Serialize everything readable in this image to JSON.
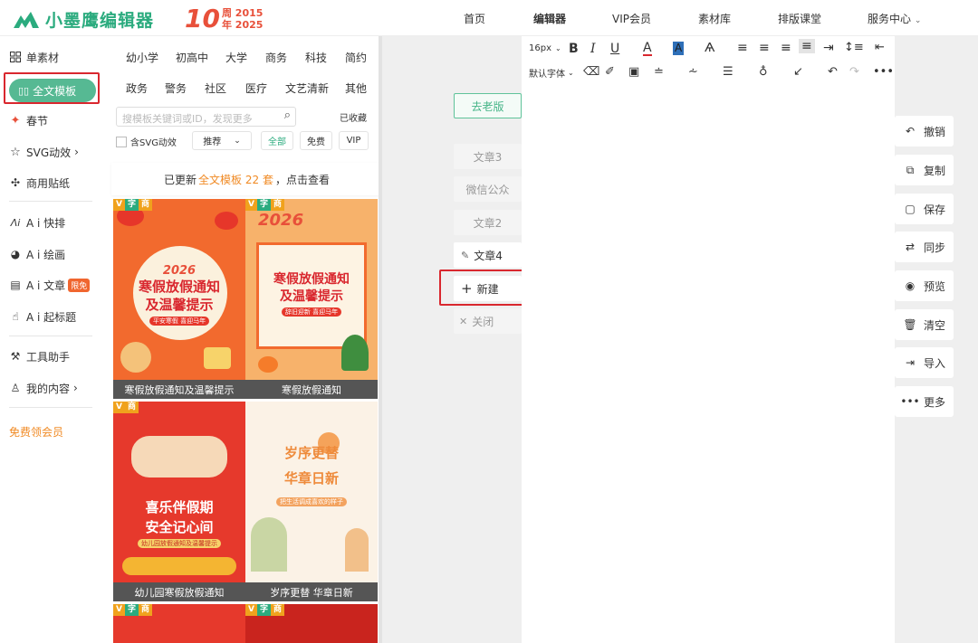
{
  "header": {
    "logo_text": "小墨鹰编辑器",
    "anniv_ten": "10",
    "anniv_line1": "周 2015",
    "anniv_line2": "年 2025",
    "nav": [
      "首页",
      "编辑器",
      "VIP会员",
      "素材库",
      "排版课堂",
      "服务中心"
    ]
  },
  "sidebar": {
    "items": [
      "单素材",
      "全文模板",
      "春节",
      "SVG动效",
      "商用贴纸",
      "A i 快排",
      "A i 绘画",
      "A i 文章",
      "A i 起标题",
      "工具助手",
      "我的内容",
      "免费领会员"
    ],
    "ai_article_badge": "限免"
  },
  "panel": {
    "categories_row1": [
      "幼小学",
      "初高中",
      "大学",
      "商务",
      "科技",
      "简约"
    ],
    "categories_row2": [
      "政务",
      "警务",
      "社区",
      "医疗",
      "文艺清新",
      "其他"
    ],
    "search_placeholder": "搜模板关键词或ID，发现更多",
    "favorites": "已收藏",
    "svg_checkbox": "含SVG动效",
    "sort": "推荐",
    "filters": [
      "全部",
      "免费",
      "VIP"
    ],
    "update_pre": "已更新",
    "update_link": "全文模板 22 套",
    "update_post": "，点击查看",
    "badge_v": "V",
    "badge_zi": "字",
    "badge_shang": "商",
    "cards": [
      {
        "caption": "寒假放假通知及温馨提示",
        "title1": "寒假放假通知",
        "title2": "及温馨提示",
        "year": "2026",
        "sub": "平安寒假 喜迎马年"
      },
      {
        "caption": "寒假放假通知",
        "title1": "寒假放假通知",
        "title2": "及温馨提示",
        "year": "2026",
        "sub": "辞旧迎新 喜迎马年"
      },
      {
        "caption": "幼儿园寒假放假通知",
        "title1": "喜乐伴假期",
        "title2": "安全记心间",
        "sub": "幼儿园放假通知及温馨提示"
      },
      {
        "caption": "岁序更替 华章日新",
        "title1": "岁序更替",
        "title2": "华章日新",
        "sub": "把生活调成喜欢的样子"
      }
    ]
  },
  "toolbar": {
    "font_size": "16px",
    "font_family": "默认字体"
  },
  "tabs": {
    "old_version": "去老版",
    "docs": [
      "文章3",
      "微信公众",
      "文章2",
      "文章4"
    ],
    "new": "新建",
    "close": "关闭"
  },
  "actions": [
    "撤销",
    "复制",
    "保存",
    "同步",
    "预览",
    "清空",
    "导入",
    "更多"
  ],
  "colors": {
    "brand": "#2bab7e",
    "accent_orange": "#f08a24",
    "highlight_red": "#d9272e"
  }
}
